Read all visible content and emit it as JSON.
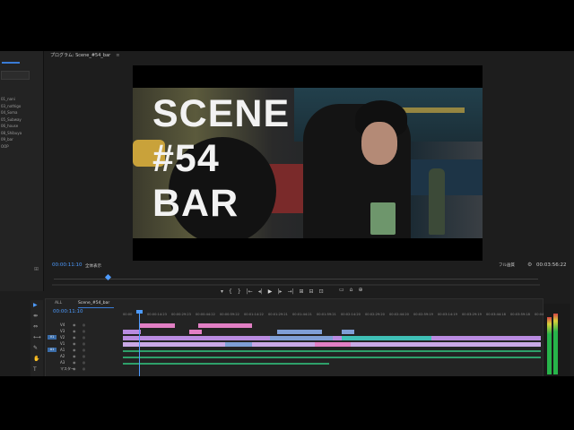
{
  "monitor": {
    "tab_label": "プログラム: Scene_#54_bar",
    "close_glyph": "≡",
    "overlay_title": "SCENE\n#54\nBAR",
    "timecode_left": "00:00:11:10",
    "fit_label": "全体表示",
    "quality_label": "フル画質",
    "timecode_right": "00:03:56:22",
    "transport": [
      "▾",
      "{",
      "}",
      "|←",
      "◂|",
      "▶",
      "|▸",
      "→|",
      "⊞",
      "⊟",
      "⊡"
    ],
    "tools_right": [
      "▭",
      "⌂",
      "⊕"
    ]
  },
  "project": {
    "items": [
      "01_nani",
      "03_nothigo",
      "04_Soma",
      "05_Subway",
      "06_house",
      "08_Shibuya",
      "09_bar",
      "OOP"
    ],
    "icon": "⊞"
  },
  "timeline": {
    "tab_all": "ALL",
    "tab_sequence": "Scene_#54_bar",
    "timecode": "00:00:11:10",
    "ruler_ticks": [
      "00:00",
      "00:00:14:23",
      "00:00:29:23",
      "00:00:44:22",
      "00:00:59:22",
      "00:01:14:22",
      "00:01:29:21",
      "00:01:44:21",
      "00:01:59:21",
      "00:02:14:20",
      "00:02:29:20",
      "00:02:44:20",
      "00:02:59:19",
      "00:03:14:19",
      "00:03:29:19",
      "00:03:44:18",
      "00:03:59:18",
      "00:04:1"
    ],
    "tracks": [
      {
        "src": "",
        "label": "V4"
      },
      {
        "src": "",
        "label": "V3"
      },
      {
        "src": "V1",
        "label": "V2"
      },
      {
        "src": "",
        "label": "V1"
      },
      {
        "src": "A1",
        "label": "A1"
      },
      {
        "src": "",
        "label": "A2"
      },
      {
        "src": "",
        "label": "A3"
      },
      {
        "src": "",
        "label": "マスター"
      }
    ]
  },
  "tools": [
    "▶",
    "⇹",
    "⇔",
    "⟷",
    "✎",
    "✋",
    "T"
  ],
  "colors": {
    "accent": "#4d9bff",
    "clip_pink": "#e27fc4",
    "clip_blue": "#7f9fd6",
    "clip_purple": "#b98be0",
    "clip_teal": "#3fbfb5",
    "audio_green": "#2ea06a"
  }
}
